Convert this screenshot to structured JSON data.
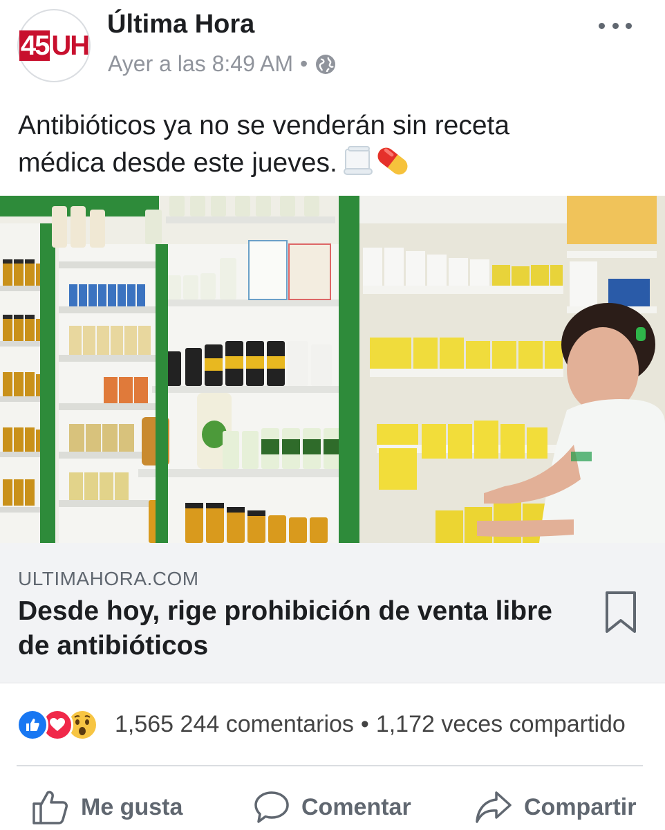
{
  "post": {
    "page_name": "Última Hora",
    "avatar_text_left": "45",
    "avatar_text_right": "UH",
    "timestamp": "Ayer a las 8:49 AM",
    "separator": "•",
    "privacy_icon": "globe-icon",
    "more_icon": "more-options-icon",
    "text_line1": "Antibióticos ya no se venderán sin receta",
    "text_line2": "médica desde este jueves.",
    "emojis": [
      "scroll-emoji",
      "pill-emoji"
    ]
  },
  "photo": {
    "description_icon": "pharmacy-photo"
  },
  "link": {
    "domain": "ULTIMAHORA.COM",
    "title": "Desde hoy, rige prohibición de venta libre de antibióticos",
    "save_icon": "bookmark-icon"
  },
  "engagement": {
    "reactions": [
      "like-reaction",
      "love-reaction",
      "wow-reaction"
    ],
    "reaction_count": "1,565",
    "comments": "244 comentarios",
    "separator": "•",
    "shares": "1,172 veces compartido"
  },
  "actions": {
    "like": "Me gusta",
    "comment": "Comentar",
    "share": "Compartir"
  },
  "colors": {
    "brand_red": "#c8102e",
    "like_blue": "#1877f2",
    "love_red": "#f02849",
    "wow_yellow": "#f7c543",
    "shelf_green": "#2e8b3a",
    "meta_gray": "#90949c"
  }
}
